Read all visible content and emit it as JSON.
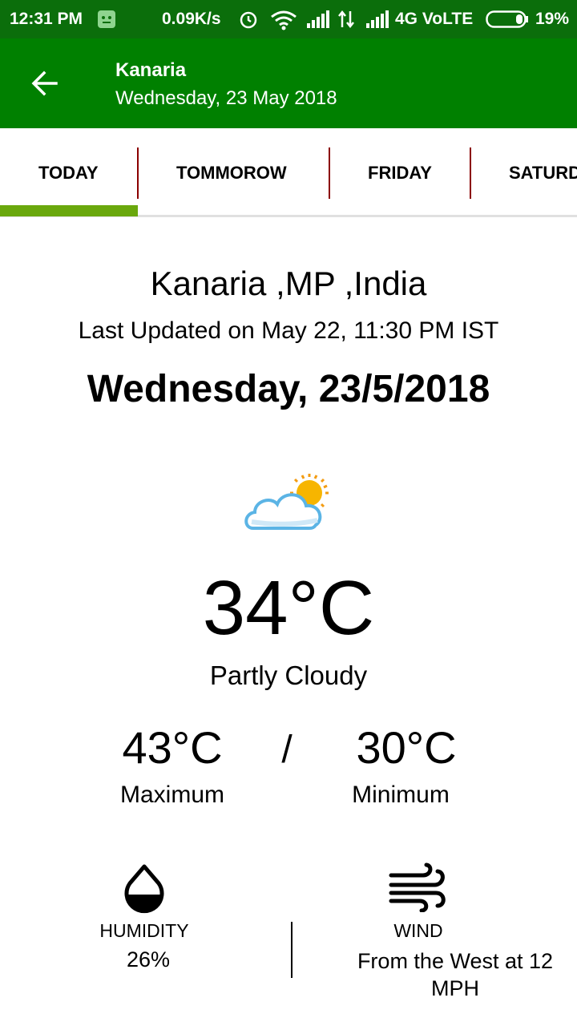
{
  "status_bar": {
    "time": "12:31 PM",
    "speed": "0.09K/s",
    "network": "4G VoLTE",
    "battery": "19%"
  },
  "app_bar": {
    "title": "Kanaria",
    "subtitle": "Wednesday, 23 May 2018",
    "back_icon": "arrow-left-icon"
  },
  "tabs": [
    {
      "label": "TODAY",
      "selected": true
    },
    {
      "label": "TOMMOROW",
      "selected": false
    },
    {
      "label": "FRIDAY",
      "selected": false
    },
    {
      "label": "SATURDAY",
      "selected": false
    }
  ],
  "weather": {
    "location": "Kanaria ,MP ,India",
    "last_updated": "Last Updated on May 22, 11:30 PM IST",
    "date": "Wednesday,  23/5/2018",
    "icon": "partly-cloudy-icon",
    "temperature": "34°C",
    "condition": "Partly Cloudy",
    "max_temp": "43°C",
    "separator": "/",
    "min_temp": "30°C",
    "max_label": "Maximum",
    "min_label": "Minimum",
    "humidity_label": "HUMIDITY",
    "humidity_value": "26%",
    "wind_label": "WIND",
    "wind_value": "From the West at 12 MPH"
  },
  "colors": {
    "status_bar": "#0b6e0b",
    "app_bar": "#008000",
    "tab_indicator": "#6aa80d",
    "tab_separator": "#8b0000"
  }
}
